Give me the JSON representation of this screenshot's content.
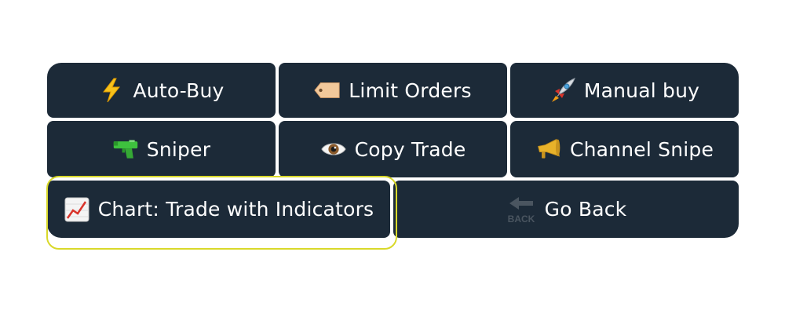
{
  "keyboard": {
    "rows": [
      [
        {
          "label": "Auto-Buy",
          "icon": "lightning-icon"
        },
        {
          "label": "Limit Orders",
          "icon": "price-tag-icon"
        },
        {
          "label": "Manual buy",
          "icon": "rocket-icon"
        }
      ],
      [
        {
          "label": "Sniper",
          "icon": "water-pistol-icon"
        },
        {
          "label": "Copy Trade",
          "icon": "eye-icon"
        },
        {
          "label": "Channel Snipe",
          "icon": "megaphone-icon"
        }
      ],
      [
        {
          "label": "Chart: Trade with Indicators",
          "icon": "chart-increasing-icon"
        },
        {
          "label": "Go Back",
          "icon": "back-arrow-icon",
          "icon_text": "BACK"
        }
      ]
    ]
  },
  "colors": {
    "button_bg": "#1c2a38",
    "button_text": "#ffffff",
    "highlight": "#d9d92a"
  }
}
